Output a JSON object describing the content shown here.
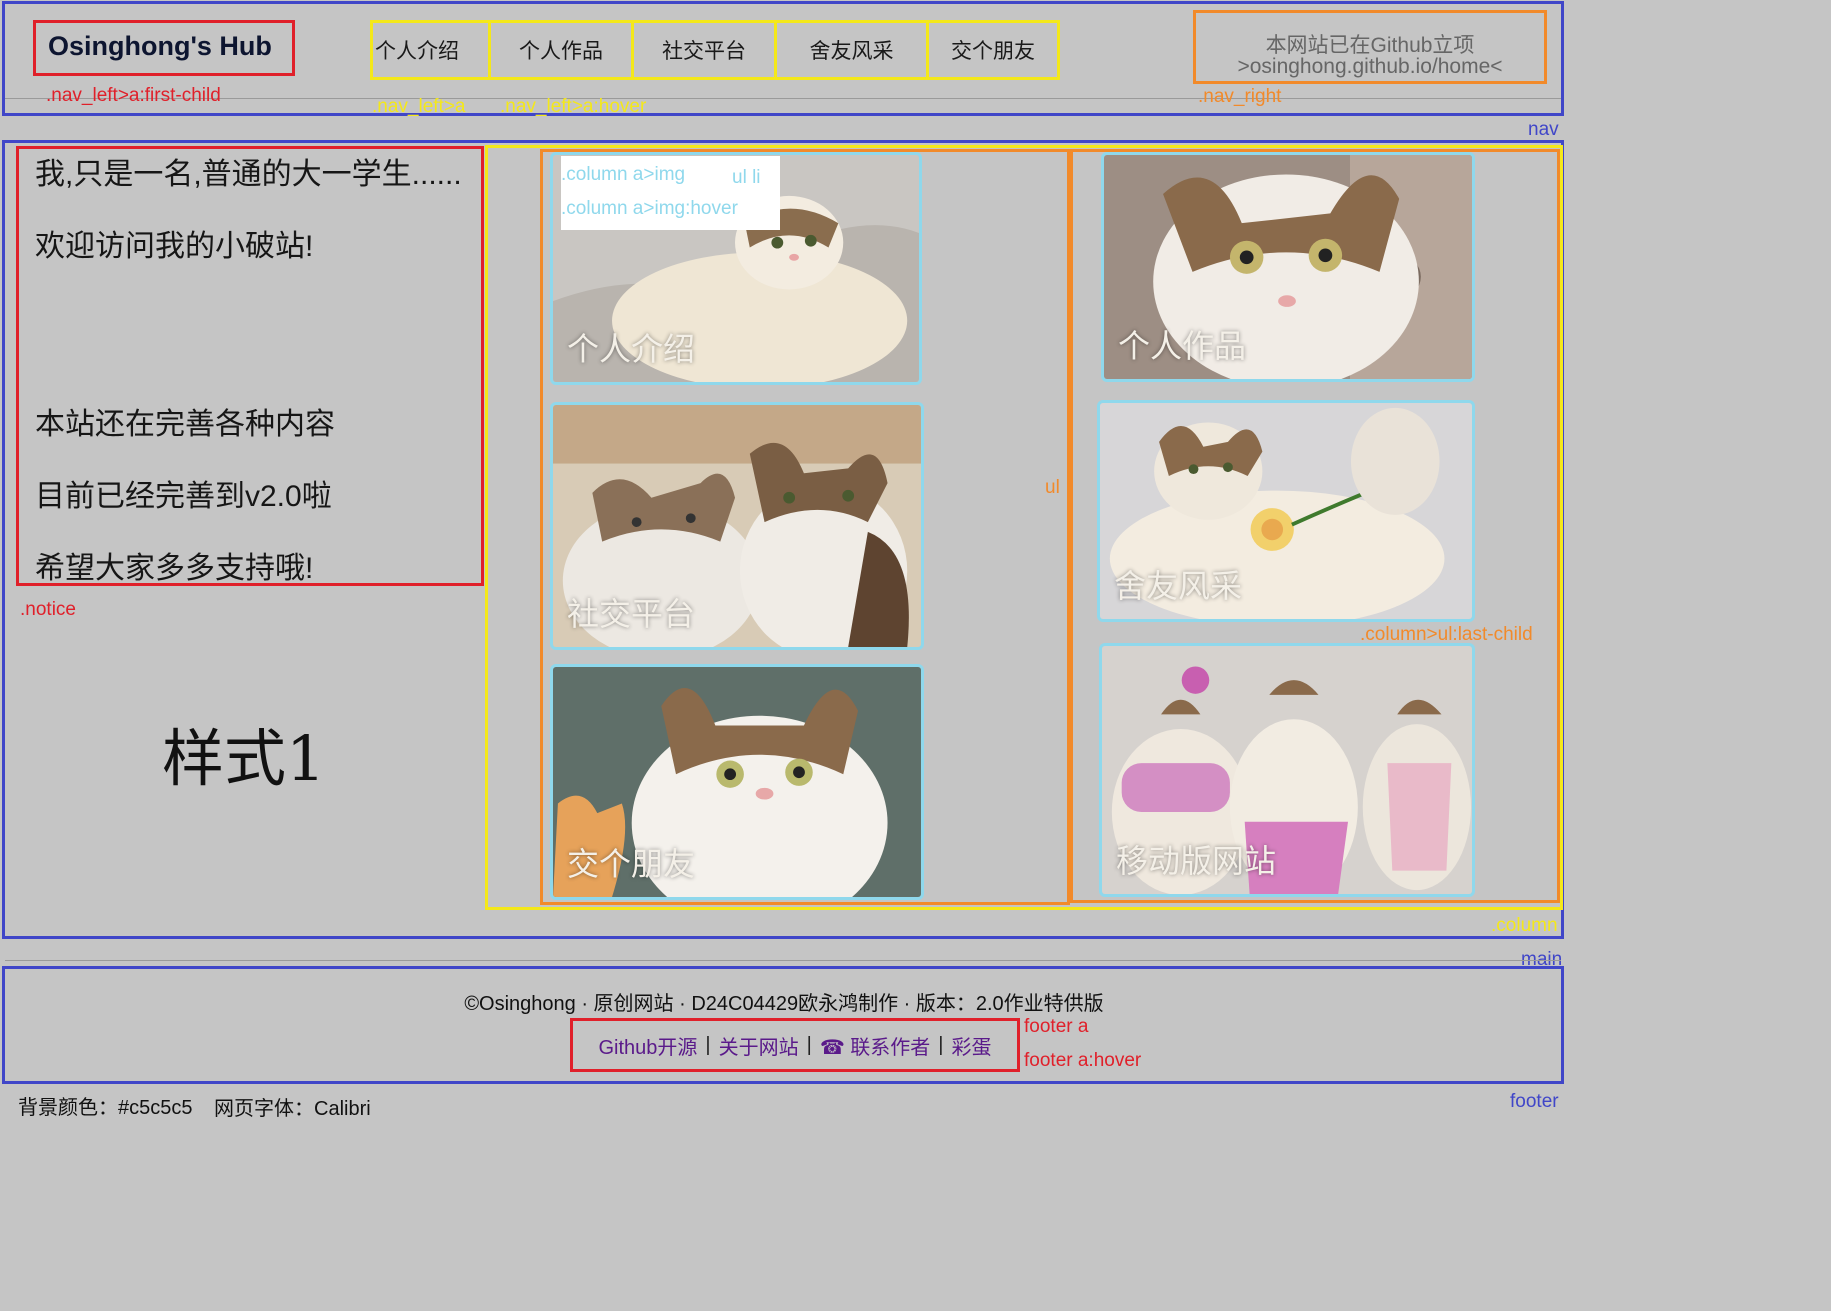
{
  "nav": {
    "logo": "Osinghong's Hub",
    "links": [
      "个人介绍",
      "个人作品",
      "社交平台",
      "舍友风采",
      "交个朋友"
    ],
    "right_line1": "本网站已在Github立项",
    "right_line2": ">osinghong.github.io/home<"
  },
  "labels": {
    "nav_left_first_child": ".nav_left>a:first-child",
    "nav_left_a": ".nav_left>a",
    "nav_left_a_hover": ".nav_left>a:hover",
    "nav_right": ".nav_right",
    "nav": "nav",
    "notice": ".notice",
    "column_img": ".column a>img",
    "column_img_hover": ".column a>img:hover",
    "ul_li": "ul li",
    "ul": "ul",
    "column_last_child": ".column>ul:last-child",
    "column": ".column",
    "main": "main",
    "footer_a": "footer a",
    "footer_a_hover": "footer a:hover",
    "footer": "footer"
  },
  "notice": {
    "line1": "我,只是一名,普通的大一学生......",
    "line2": "欢迎访问我的小破站!",
    "line3": "本站还在完善各种内容",
    "line4": "目前已经完善到v2.0啦",
    "line5": "希望大家多多支持哦!",
    "style_label": "样式1"
  },
  "photos": {
    "p1": "个人介绍",
    "p2": "个人作品",
    "p3": "社交平台",
    "p4": "舍友风采",
    "p5": "交个朋友",
    "p6": "移动版网站"
  },
  "footer": {
    "copyright": "©Osinghong · 原创网站 · D24C04429欧永鸿制作 · 版本：2.0作业特供版",
    "links": [
      "Github开源",
      "关于网站",
      "☎ 联系作者",
      "彩蛋"
    ],
    "separator": "|"
  },
  "bottom": {
    "bg_color_note": "背景颜色：#c5c5c5",
    "font_note": "网页字体：Calibri"
  },
  "colors": {
    "background": "#c5c5c5",
    "blue": "#4046c8",
    "red": "#e0202a",
    "yellow": "#f4e81a",
    "orange": "#f28a2a",
    "cyan": "#8fd8ec"
  }
}
